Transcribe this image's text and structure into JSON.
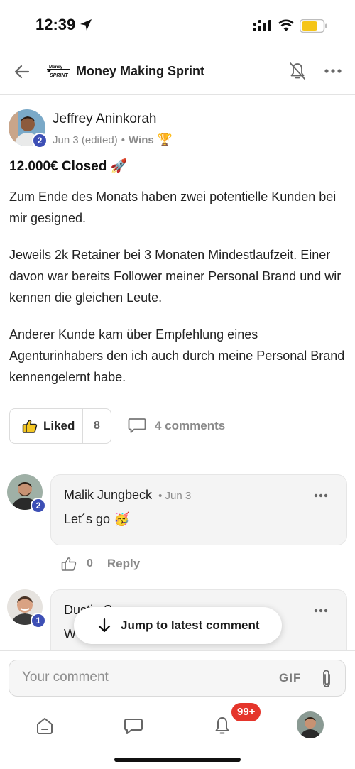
{
  "status_bar": {
    "time": "12:39"
  },
  "header": {
    "group_name": "Money Making Sprint",
    "logo_text_top": "Money",
    "logo_text_bottom": "SPRINT"
  },
  "post": {
    "author": "Jeffrey Aninkorah",
    "level": "2",
    "date": "Jun 3 (edited)",
    "separator": "•",
    "category": "Wins",
    "category_icon": "🏆",
    "title": "12.000€ Closed 🚀",
    "paragraphs": [
      "Zum Ende des Monats haben zwei potentielle Kunden bei mir gesigned.",
      "Jeweils 2k Retainer bei 3 Monaten Mindestlaufzeit. Einer davon war bereits Follower meiner Personal Brand und wir kennen die gleichen Leute.",
      "Anderer Kunde kam über Empfehlung eines Agenturinhabers den ich auch durch meine Personal Brand kennengelernt habe."
    ],
    "like_label": "Liked",
    "like_count": "8",
    "comments_label": "4 comments"
  },
  "comments": [
    {
      "author": "Malik Jungbeck",
      "date": "• Jun 3",
      "text": "Let´s go 🥳",
      "level": "2",
      "like_count": "0",
      "reply_label": "Reply"
    },
    {
      "author": "Dustin S",
      "date": "",
      "text": "W",
      "level": "1"
    }
  ],
  "jump_button": {
    "label": "Jump to latest comment"
  },
  "composer": {
    "placeholder": "Your comment",
    "gif_label": "GIF"
  },
  "bottom_nav": {
    "notification_count": "99+"
  },
  "colors": {
    "badge_blue": "#3d4fb5",
    "notif_red": "#e5352b"
  }
}
